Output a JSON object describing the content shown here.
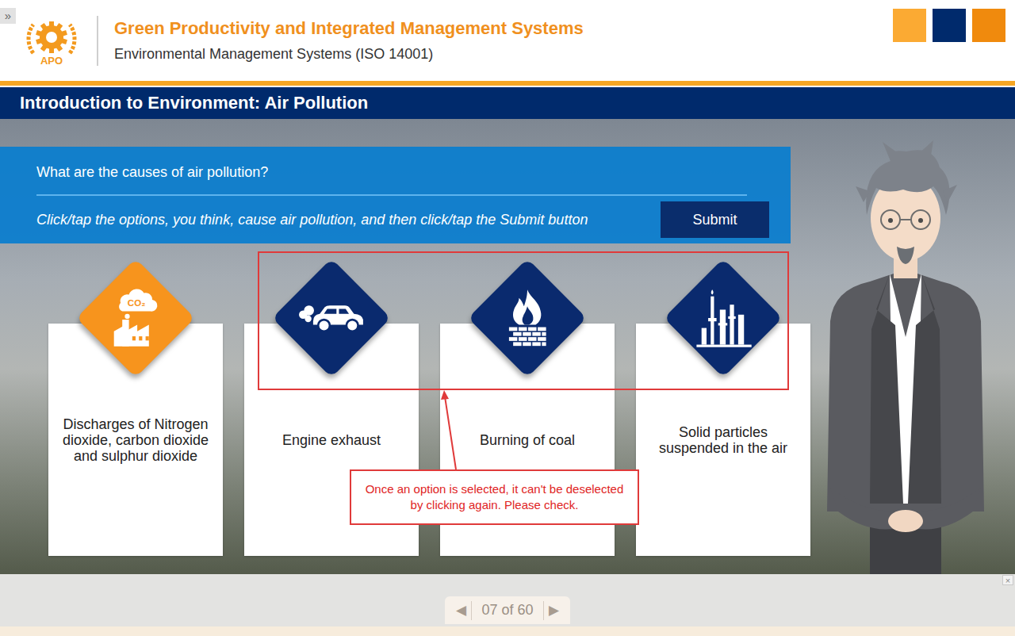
{
  "sidebar_toggle": "»",
  "header": {
    "logo_text": "APO",
    "title": "Green Productivity and Integrated Management Systems",
    "subtitle": "Environmental Management Systems (ISO 14001)"
  },
  "slide_title": "Introduction to Environment: Air Pollution",
  "question": {
    "text": "What are the causes of air pollution?",
    "instruction": "Click/tap the options, you think, cause air pollution, and then click/tap the Submit button",
    "submit": "Submit"
  },
  "options": [
    {
      "label": "Discharges of Nitrogen dioxide, carbon dioxide and sulphur dioxide",
      "selected": true,
      "kind": "factory",
      "icon_text": "CO₂"
    },
    {
      "label": "Engine exhaust",
      "selected": false,
      "kind": "car"
    },
    {
      "label": "Burning of coal",
      "selected": false,
      "kind": "fire"
    },
    {
      "label": "Solid particles suspended in the air",
      "selected": false,
      "kind": "refinery"
    }
  ],
  "annotation": {
    "note": "Once an option is selected, it can't be deselected by clicking again. Please check."
  },
  "navigation": {
    "prev": "◀",
    "page": "07 of 60",
    "next": "▶"
  },
  "close": "×"
}
